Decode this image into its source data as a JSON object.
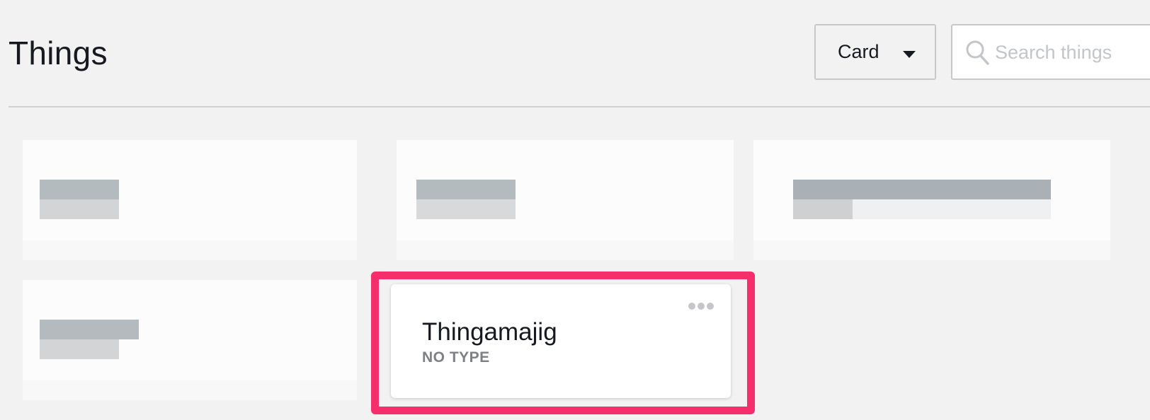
{
  "header": {
    "title": "Things",
    "view_select": {
      "selected": "Card",
      "icon": "chevron-down-icon"
    },
    "search": {
      "placeholder": "Search things",
      "value": "",
      "icon": "search-icon"
    }
  },
  "cards": [
    {
      "title": "Thingamajig",
      "subtitle": "NO TYPE",
      "menu_icon": "more-icon",
      "highlighted": true,
      "highlight_color": "#f72e6c"
    }
  ],
  "blurred_cards": 4,
  "colors": {
    "background": "#f2f2f2",
    "card": "#ffffff",
    "highlight": "#f72e6c",
    "subtitle": "#7d8084"
  }
}
